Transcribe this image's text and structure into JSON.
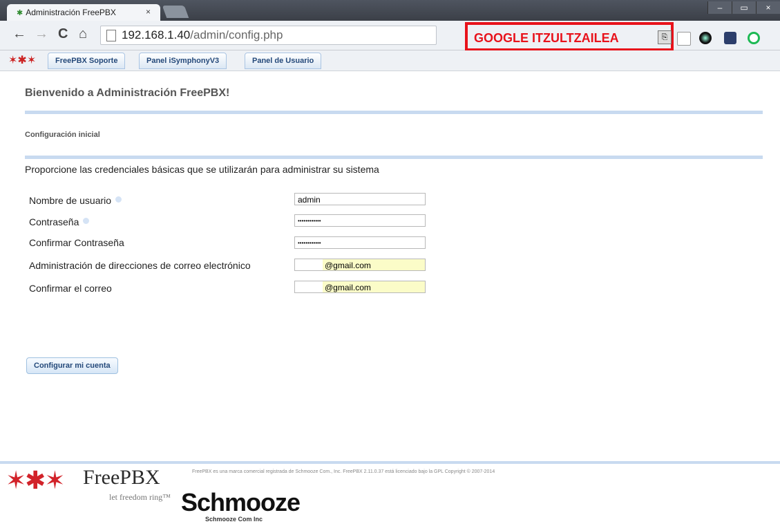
{
  "browser": {
    "tab_title": "Administración FreePBX",
    "tab_close": "×",
    "url_host": "192.168.1.40",
    "url_path": "/admin/config.php",
    "window_controls": [
      "–",
      "▭",
      "×"
    ]
  },
  "annotation": {
    "label": "GOOGLE ITZULTZAILEA",
    "color": "#e8121b"
  },
  "bookmarks": [
    {
      "label": "FreePBX Soporte"
    },
    {
      "label": "Panel iSymphonyV3"
    },
    {
      "label": "Panel de Usuario"
    }
  ],
  "page": {
    "welcome": "Bienvenido a Administración FreePBX!",
    "section": "Configuración inicial",
    "intro": "Proporcione las credenciales básicas que se utilizarán para administrar su sistema",
    "fields": {
      "username_label": "Nombre de usuario",
      "username_value": "admin",
      "password_label": "Contraseña",
      "password_value": "••••••••••••",
      "confirm_password_label": "Confirmar Contraseña",
      "confirm_password_value": "••••••••••••",
      "email_label": "Administración de direcciones de correo electrónico",
      "email_value": "@gmail.com",
      "confirm_email_label": "Confirmar el correo",
      "confirm_email_value": "@gmail.com"
    },
    "submit_label": "Configurar mi cuenta"
  },
  "footer": {
    "brand": "FreePBX",
    "tagline": "let freedom ring™",
    "legal": "FreePBX es una marca comercial registrada de Schmooze Com., Inc. FreePBX 2.11.0.37 está licenciado bajo la GPL Copyright © 2007-2014",
    "company": "Schmooze",
    "company_sub": "Schmooze Com Inc"
  }
}
